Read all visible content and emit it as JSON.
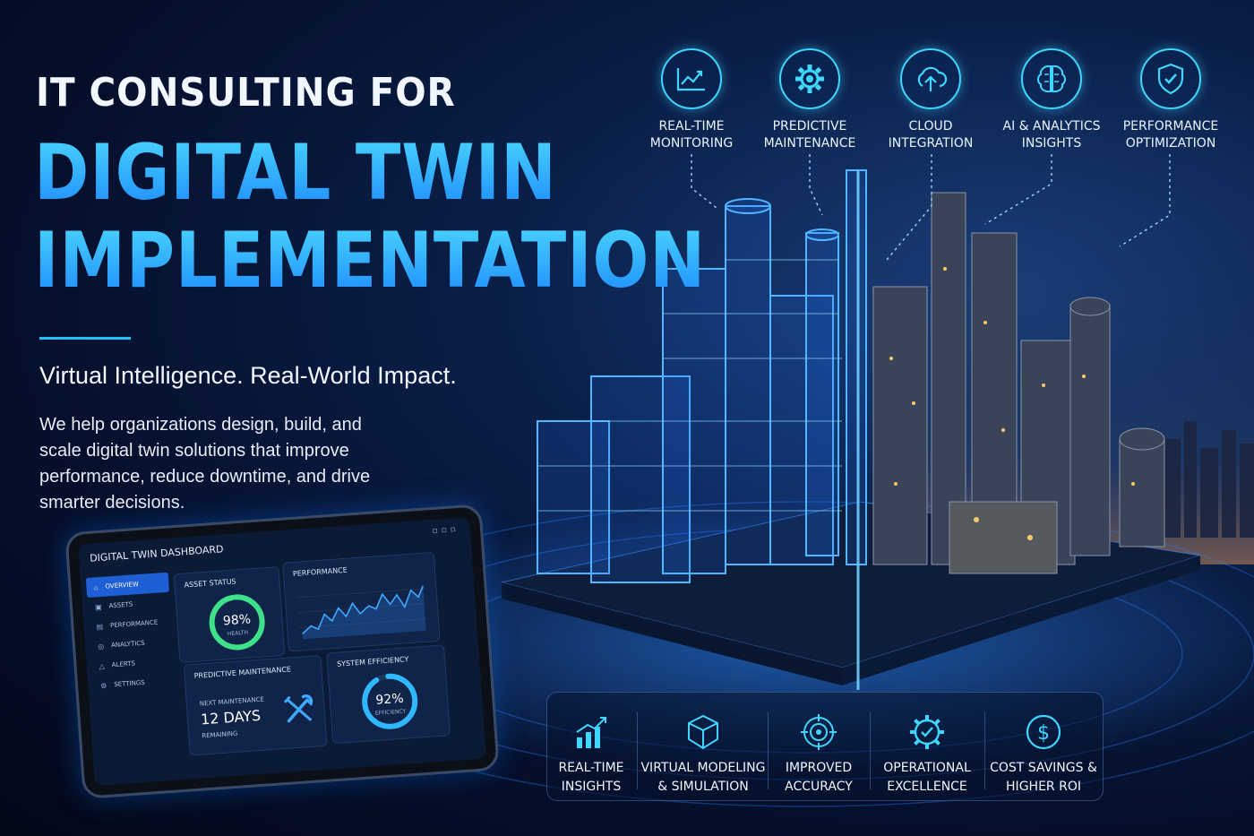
{
  "headline": {
    "top": "IT CONSULTING FOR",
    "line1": "DIGITAL TWIN",
    "line2": "IMPLEMENTATION"
  },
  "tagline": "Virtual Intelligence. Real-World Impact.",
  "description": "We help organizations design, build, and scale digital twin solutions that improve performance, reduce downtime, and drive smarter decisions.",
  "features": [
    {
      "line1": "REAL-TIME",
      "line2": "MONITORING",
      "icon": "line-chart-icon"
    },
    {
      "line1": "PREDICTIVE",
      "line2": "MAINTENANCE",
      "icon": "gear-icon"
    },
    {
      "line1": "CLOUD",
      "line2": "INTEGRATION",
      "icon": "cloud-upload-icon"
    },
    {
      "line1": "AI & ANALYTICS",
      "line2": "INSIGHTS",
      "icon": "brain-icon"
    },
    {
      "line1": "PERFORMANCE",
      "line2": "OPTIMIZATION",
      "icon": "shield-check-icon"
    }
  ],
  "benefits": [
    {
      "line1": "REAL-TIME",
      "line2": "INSIGHTS",
      "icon": "bar-chart-icon"
    },
    {
      "line1": "VIRTUAL MODELING",
      "line2": "& SIMULATION",
      "icon": "cube-icon"
    },
    {
      "line1": "IMPROVED",
      "line2": "ACCURACY",
      "icon": "target-icon"
    },
    {
      "line1": "OPERATIONAL",
      "line2": "EXCELLENCE",
      "icon": "gear-check-icon"
    },
    {
      "line1": "COST SAVINGS &",
      "line2": "HIGHER ROI",
      "icon": "dollar-icon"
    }
  ],
  "dashboard": {
    "title": "DIGITAL TWIN DASHBOARD",
    "nav": [
      "OVERVIEW",
      "ASSETS",
      "PERFORMANCE",
      "ANALYTICS",
      "ALERTS",
      "SETTINGS"
    ],
    "asset_status": {
      "title": "ASSET STATUS",
      "value": "98%",
      "sub": "HEALTH",
      "fraction": 0.98
    },
    "performance": {
      "title": "PERFORMANCE"
    },
    "maintenance": {
      "title": "PREDICTIVE MAINTENANCE",
      "pre": "NEXT MAINTENANCE",
      "value": "12 DAYS",
      "post": "REMAINING"
    },
    "efficiency": {
      "title": "SYSTEM EFFICIENCY",
      "value": "92%",
      "sub": "EFFICIENCY",
      "fraction": 0.92
    }
  },
  "colors": {
    "accent": "#3fd6ff",
    "headline_blue": "#1f8dff",
    "background": "#050f2b",
    "gauge_green": "#3ee08a"
  }
}
